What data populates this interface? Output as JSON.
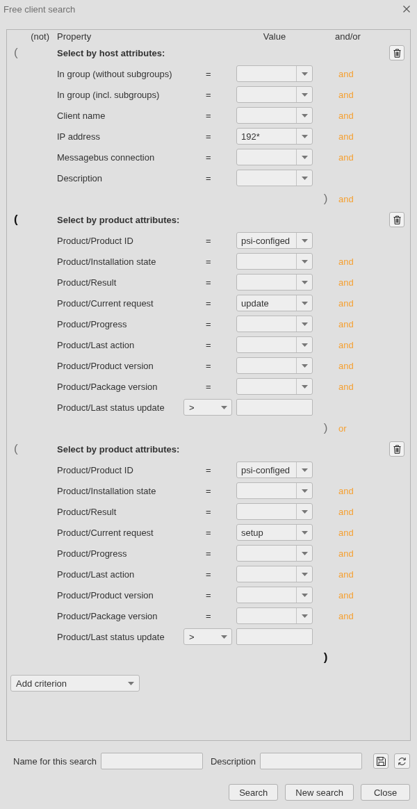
{
  "window": {
    "title": "Free client search"
  },
  "header": {
    "not": "(not)",
    "property": "Property",
    "value": "Value",
    "connector": "and/or"
  },
  "groups": [
    {
      "open_paren": {
        "text": "(",
        "active": false
      },
      "title": "Select by host attributes:",
      "rows": [
        {
          "kind": "combo",
          "property": "In group (without subgroups)",
          "operator": "=",
          "connector": "and"
        },
        {
          "kind": "combo",
          "property": "In group (incl. subgroups)",
          "operator": "=",
          "connector": "and"
        },
        {
          "kind": "combo",
          "property": "Client name",
          "operator": "=",
          "connector": "and"
        },
        {
          "kind": "combo",
          "property": "IP address",
          "operator": "=",
          "value": "192*",
          "connector": "and"
        },
        {
          "kind": "combo",
          "property": "Messagebus connection",
          "operator": "=",
          "connector": "and"
        },
        {
          "kind": "combo",
          "property": "Description",
          "operator": "="
        }
      ],
      "close_paren": {
        "text": ")",
        "active": false
      },
      "connector": "and"
    },
    {
      "open_paren": {
        "text": "(",
        "active": true
      },
      "title": "Select by product attributes:",
      "rows": [
        {
          "kind": "combo",
          "property": "Product/Product ID",
          "operator": "=",
          "value": "psi-configed"
        },
        {
          "kind": "combo",
          "property": "Product/Installation state",
          "operator": "=",
          "connector": "and"
        },
        {
          "kind": "combo",
          "property": "Product/Result",
          "operator": "=",
          "connector": "and"
        },
        {
          "kind": "combo",
          "property": "Product/Current request",
          "operator": "=",
          "value": "update",
          "connector": "and"
        },
        {
          "kind": "combo",
          "property": "Product/Progress",
          "operator": "=",
          "connector": "and"
        },
        {
          "kind": "combo",
          "property": "Product/Last action",
          "operator": "=",
          "connector": "and"
        },
        {
          "kind": "combo",
          "property": "Product/Product version",
          "operator": "=",
          "connector": "and"
        },
        {
          "kind": "combo",
          "property": "Product/Package version",
          "operator": "=",
          "connector": "and"
        },
        {
          "kind": "compare",
          "property": "Product/Last status update",
          "operator": ">"
        }
      ],
      "close_paren": {
        "text": ")",
        "active": false
      },
      "connector": "or"
    },
    {
      "open_paren": {
        "text": "(",
        "active": false
      },
      "title": "Select by product attributes:",
      "rows": [
        {
          "kind": "combo",
          "property": "Product/Product ID",
          "operator": "=",
          "value": "psi-configed"
        },
        {
          "kind": "combo",
          "property": "Product/Installation state",
          "operator": "=",
          "connector": "and"
        },
        {
          "kind": "combo",
          "property": "Product/Result",
          "operator": "=",
          "connector": "and"
        },
        {
          "kind": "combo",
          "property": "Product/Current request",
          "operator": "=",
          "value": "setup",
          "connector": "and"
        },
        {
          "kind": "combo",
          "property": "Product/Progress",
          "operator": "=",
          "connector": "and"
        },
        {
          "kind": "combo",
          "property": "Product/Last action",
          "operator": "=",
          "connector": "and"
        },
        {
          "kind": "combo",
          "property": "Product/Product version",
          "operator": "=",
          "connector": "and"
        },
        {
          "kind": "combo",
          "property": "Product/Package version",
          "operator": "=",
          "connector": "and"
        },
        {
          "kind": "compare",
          "property": "Product/Last status update",
          "operator": ">"
        }
      ],
      "close_paren": {
        "text": ")",
        "active": true
      }
    }
  ],
  "add_criterion": {
    "label": "Add criterion"
  },
  "search_name": {
    "label": "Name for this search"
  },
  "search_description": {
    "label": "Description"
  },
  "buttons": [
    "Search",
    "New search",
    "Close"
  ]
}
